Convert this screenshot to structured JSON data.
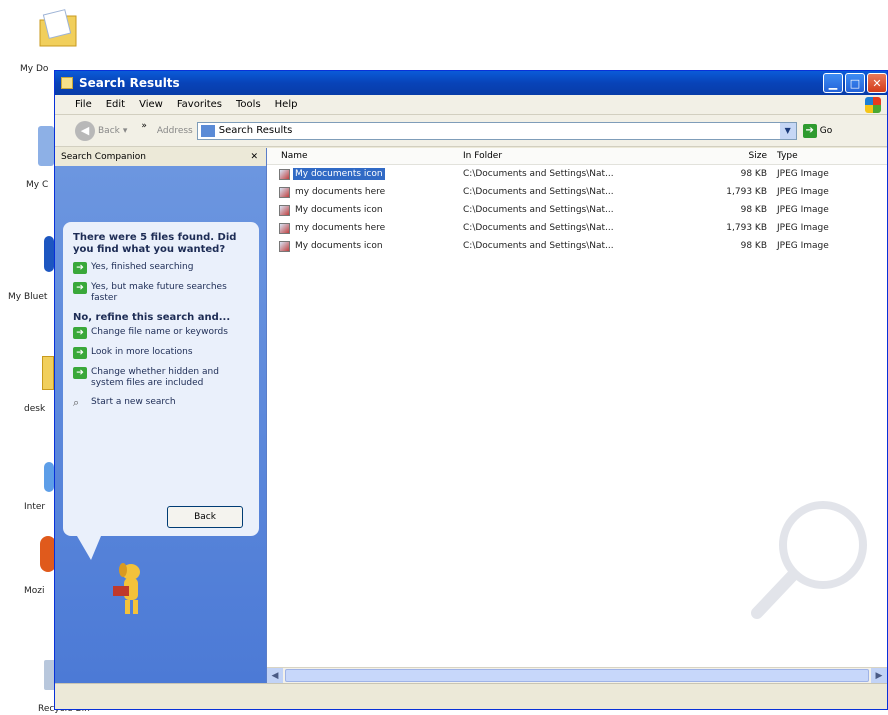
{
  "desktop": {
    "icons": [
      {
        "label": "My Do",
        "icon": "my-documents-icon"
      },
      {
        "label": "My C",
        "icon": "my-computer-icon"
      },
      {
        "label": "My Bluet",
        "icon": "bluetooth-icon"
      },
      {
        "label": "desk",
        "icon": "desktop-folder-icon"
      },
      {
        "label": "Inter",
        "icon": "internet-explorer-icon"
      },
      {
        "label": "Mozi",
        "icon": "mozilla-icon"
      },
      {
        "label": "Recycle Bin",
        "icon": "recycle-bin-icon"
      }
    ]
  },
  "window": {
    "title": "Search Results",
    "menu": [
      "File",
      "Edit",
      "View",
      "Favorites",
      "Tools",
      "Help"
    ],
    "toolbar": {
      "back_label": "Back",
      "chevron": "»",
      "address_label": "Address",
      "address_value": "Search Results",
      "go_label": "Go"
    }
  },
  "companion": {
    "header": "Search Companion",
    "close": "✕",
    "heading": "There were 5 files found. Did you find what you wanted?",
    "yes_options": [
      "Yes, finished searching",
      "Yes, but make future searches faster"
    ],
    "refine_heading": "No, refine this search and...",
    "refine_options": [
      "Change file name or keywords",
      "Look in more locations",
      "Change whether hidden and system files are included"
    ],
    "new_search": "Start a new search",
    "back_button": "Back"
  },
  "filelist": {
    "columns": {
      "name": "Name",
      "folder": "In Folder",
      "size": "Size",
      "type": "Type"
    },
    "rows": [
      {
        "name": "My documents icon",
        "folder": "C:\\Documents and Settings\\Nat...",
        "size": "98 KB",
        "type": "JPEG Image"
      },
      {
        "name": "my documents here",
        "folder": "C:\\Documents and Settings\\Nat...",
        "size": "1,793 KB",
        "type": "JPEG Image"
      },
      {
        "name": "My documents icon",
        "folder": "C:\\Documents and Settings\\Nat...",
        "size": "98 KB",
        "type": "JPEG Image"
      },
      {
        "name": "my documents here",
        "folder": "C:\\Documents and Settings\\Nat...",
        "size": "1,793 KB",
        "type": "JPEG Image"
      },
      {
        "name": "My documents icon",
        "folder": "C:\\Documents and Settings\\Nat...",
        "size": "98 KB",
        "type": "JPEG Image"
      }
    ]
  },
  "colors": {
    "titlebar": "#0a5bd8",
    "selection": "#316ac5",
    "companion_bg": "#6d97e0"
  }
}
